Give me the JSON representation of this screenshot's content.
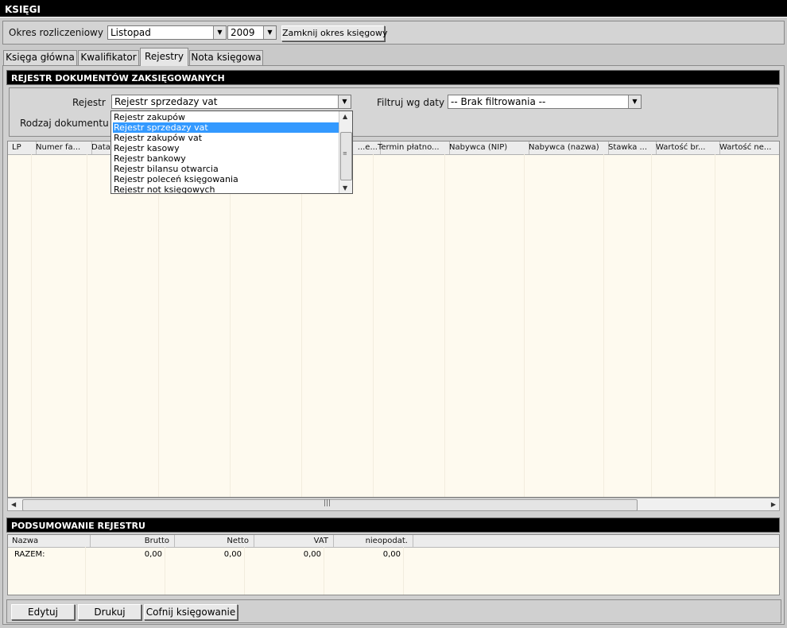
{
  "app": {
    "title": "KSIĘGI"
  },
  "toolbar": {
    "period_label": "Okres rozliczeniowy",
    "month_value": "Listopad",
    "year_value": "2009",
    "close_period_button": "Zamknij okres księgowy"
  },
  "tabs": [
    {
      "label": "Księga główna",
      "active": false
    },
    {
      "label": "Kwalifikator",
      "active": false
    },
    {
      "label": "Rejestry",
      "active": true
    },
    {
      "label": "Nota księgowa",
      "active": false
    }
  ],
  "register": {
    "section_title": "REJESTR DOKUMENTÓW ZAKSIĘGOWANYCH",
    "register_label": "Rejestr",
    "register_value": "Rejestr sprzedazy vat",
    "date_filter_label": "Filtruj wg daty",
    "date_filter_value": "-- Brak filtrowania --",
    "doc_type_label": "Rodzaj dokumentu",
    "dropdown_options": [
      "Rejestr zakupów",
      "Rejestr sprzedazy vat",
      "Rejestr zakupów vat",
      "Rejestr kasowy",
      "Rejestr bankowy",
      "Rejestr bilansu otwarcia",
      "Rejestr poleceń księgowania",
      "Rejestr not księgowych"
    ],
    "dropdown_selected_index": 1,
    "columns": [
      "LP",
      "Numer fa...",
      "Data",
      "",
      "",
      "...e...",
      "Termin płatno...",
      "Nabywca (NIP)",
      "Nabywca (nazwa)",
      "Stawka ...",
      "Wartość br...",
      "Wartość ne..."
    ],
    "rows": []
  },
  "summary": {
    "section_title": "PODSUMOWANIE REJESTRU",
    "columns": [
      "Nazwa",
      "Brutto",
      "Netto",
      "VAT",
      "nieopodat."
    ],
    "rows": [
      {
        "name": "RAZEM:",
        "brutto": "0,00",
        "netto": "0,00",
        "vat": "0,00",
        "nieopodat": "0,00"
      }
    ]
  },
  "actions": {
    "edit": "Edytuj",
    "print": "Drukuj",
    "unpost": "Cofnij księgowanie"
  },
  "icons": {
    "combo_arrow": "chevron-down-icon",
    "scroll_left": "arrow-left-icon",
    "scroll_right": "arrow-right-icon",
    "scroll_up": "arrow-up-icon",
    "scroll_down": "arrow-down-icon",
    "grip": "scroll-grip-icon"
  }
}
